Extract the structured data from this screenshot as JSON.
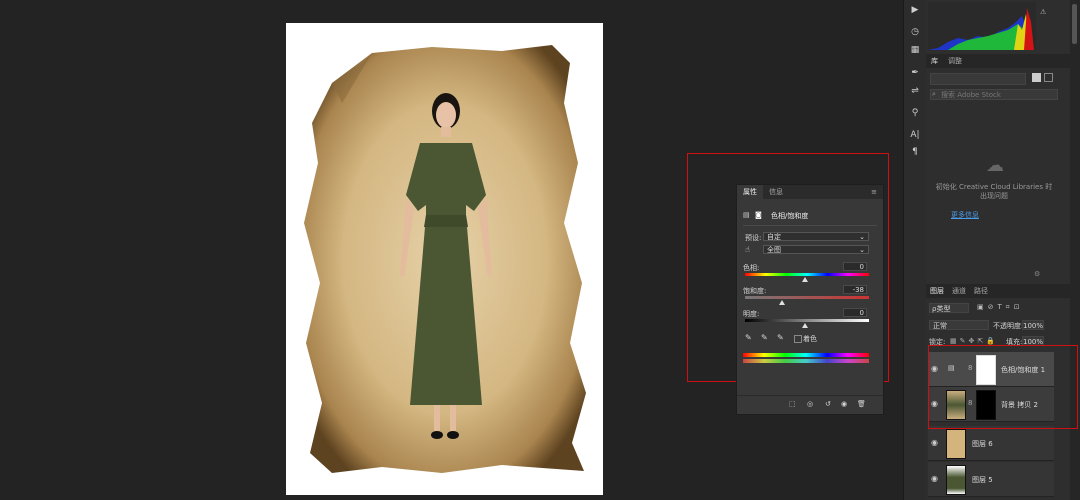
{
  "properties_panel": {
    "tabs": [
      "属性",
      "信息"
    ],
    "adjustment_title": "色相/饱和度",
    "preset_label": "预设:",
    "preset_value": "自定",
    "channel_value": "全图",
    "hue_label": "色相:",
    "hue_value": "0",
    "saturation_label": "饱和度:",
    "saturation_value": "-38",
    "lightness_label": "明度:",
    "lightness_value": "0",
    "colorize_label": "着色"
  },
  "library_panel": {
    "tabs": [
      "库",
      "调整"
    ],
    "search_placeholder": "搜索 Adobe Stock",
    "message": "初始化 Creative Cloud Libraries 时出现问题",
    "more_info": "更多信息"
  },
  "layers_panel": {
    "tabs": [
      "图层",
      "通道",
      "路径"
    ],
    "filter_label": "ρ类型",
    "blend_mode": "正常",
    "opacity_label": "不透明度:",
    "opacity_value": "100%",
    "lock_label": "锁定:",
    "fill_label": "填充:",
    "fill_value": "100%",
    "layers": [
      {
        "name": "色相/饱和度 1"
      },
      {
        "name": "背景 拷贝 2"
      },
      {
        "name": "图层 6"
      },
      {
        "name": "图层 5"
      }
    ]
  },
  "colors": {
    "highlight": "#d01010",
    "accent_link": "#4a9be8"
  }
}
